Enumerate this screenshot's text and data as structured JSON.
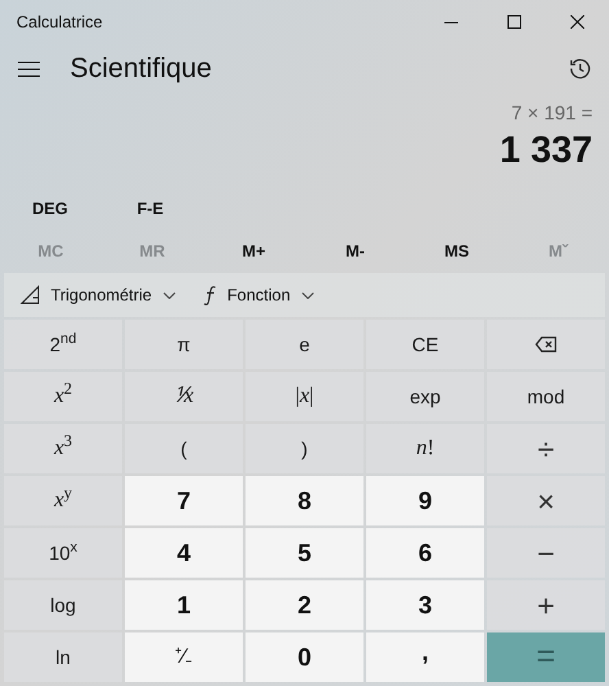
{
  "window": {
    "title": "Calculatrice"
  },
  "header": {
    "mode": "Scientifique"
  },
  "display": {
    "expression": "7 × 191 =",
    "result": "1 337"
  },
  "angle_buttons": [
    {
      "label": "DEG"
    },
    {
      "label": "F-E"
    }
  ],
  "memory_buttons": [
    {
      "label": "MC",
      "disabled": true
    },
    {
      "label": "MR",
      "disabled": true
    },
    {
      "label": "M+",
      "disabled": false
    },
    {
      "label": "M-",
      "disabled": false
    },
    {
      "label": "MS",
      "disabled": false
    },
    {
      "label": "Mˇ",
      "disabled": true
    }
  ],
  "toolbar": [
    {
      "label": "Trigonométrie",
      "kind": "trigonometry"
    },
    {
      "label": "Fonction",
      "kind": "function"
    }
  ],
  "keys": [
    {
      "label": "2$^{nd}$",
      "kind": "function"
    },
    {
      "label": "π",
      "kind": "function"
    },
    {
      "label": "e",
      "kind": "function"
    },
    {
      "label": "CE",
      "kind": "function"
    },
    {
      "kind": "backspace"
    },
    {
      "label": "*x*$^{2}$",
      "kind": "math"
    },
    {
      "label": "⅟x",
      "kind": "reciprocal"
    },
    {
      "label": "|*x*|",
      "kind": "math"
    },
    {
      "label": "exp",
      "kind": "function"
    },
    {
      "label": "mod",
      "kind": "function"
    },
    {
      "label": "*x*$^{3}$",
      "kind": "math"
    },
    {
      "label": "(",
      "kind": "function"
    },
    {
      "label": ")",
      "kind": "function"
    },
    {
      "label": "*n*!",
      "kind": "math"
    },
    {
      "label": "÷",
      "kind": "operator"
    },
    {
      "label": "*x*$^{y}$",
      "kind": "math"
    },
    {
      "label": "7",
      "kind": "digit"
    },
    {
      "label": "8",
      "kind": "digit"
    },
    {
      "label": "9",
      "kind": "digit"
    },
    {
      "label": "×",
      "kind": "operator"
    },
    {
      "label": "10$^{x}$",
      "kind": "function"
    },
    {
      "label": "4",
      "kind": "digit"
    },
    {
      "label": "5",
      "kind": "digit"
    },
    {
      "label": "6",
      "kind": "digit"
    },
    {
      "label": "−",
      "kind": "operator"
    },
    {
      "label": "log",
      "kind": "function"
    },
    {
      "label": "1",
      "kind": "digit"
    },
    {
      "label": "2",
      "kind": "digit"
    },
    {
      "label": "3",
      "kind": "digit"
    },
    {
      "label": "+",
      "kind": "operator"
    },
    {
      "label": "ln",
      "kind": "function"
    },
    {
      "label": "⁺∕₋",
      "kind": "digitlight"
    },
    {
      "label": "0",
      "kind": "digit"
    },
    {
      "label": ",",
      "kind": "decimal"
    },
    {
      "label": "=",
      "kind": "equals"
    }
  ]
}
